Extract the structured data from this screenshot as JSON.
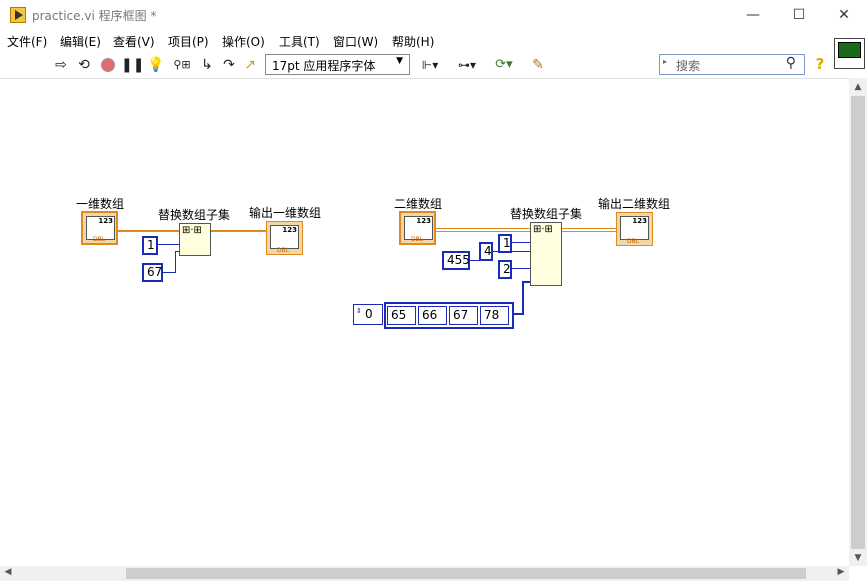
{
  "window": {
    "title": "practice.vi 程序框图 *",
    "minimize": "—",
    "maximize": "☐",
    "close": "✕"
  },
  "menu": [
    "文件(F)",
    "编辑(E)",
    "查看(V)",
    "项目(P)",
    "操作(O)",
    "工具(T)",
    "窗口(W)",
    "帮助(H)"
  ],
  "toolbar": {
    "font": "17pt 应用程序字体",
    "search_placeholder": "搜索",
    "help": "?",
    "icons": [
      "run-arrow-icon",
      "run-continuously-icon",
      "abort-icon",
      "pause-icon",
      "highlight-execution-icon",
      "retain-wire-values-icon",
      "step-into-icon",
      "step-over-icon",
      "step-out-icon",
      "align-icon",
      "distribute-icon",
      "reorder-icon",
      "cleanup-diagram-icon"
    ]
  },
  "diagram": {
    "left": {
      "input_label": "一维数组",
      "function_label": "替换数组子集",
      "output_label": "输出一维数组",
      "index_const": "1",
      "value_const": "67"
    },
    "right": {
      "input_label": "二维数组",
      "function_label": "替换数组子集",
      "output_label": "输出二维数组",
      "const_455": "455",
      "const_4": "4",
      "row_const": "1",
      "col_const": "2",
      "array_index": "0",
      "array_values": [
        "65",
        "66",
        "67",
        "78"
      ]
    },
    "terminal_type": "DBL",
    "terminal_glyph": "123"
  },
  "colors": {
    "orange_wire": "#e08a1e",
    "blue_wire": "#1a2bb8"
  }
}
